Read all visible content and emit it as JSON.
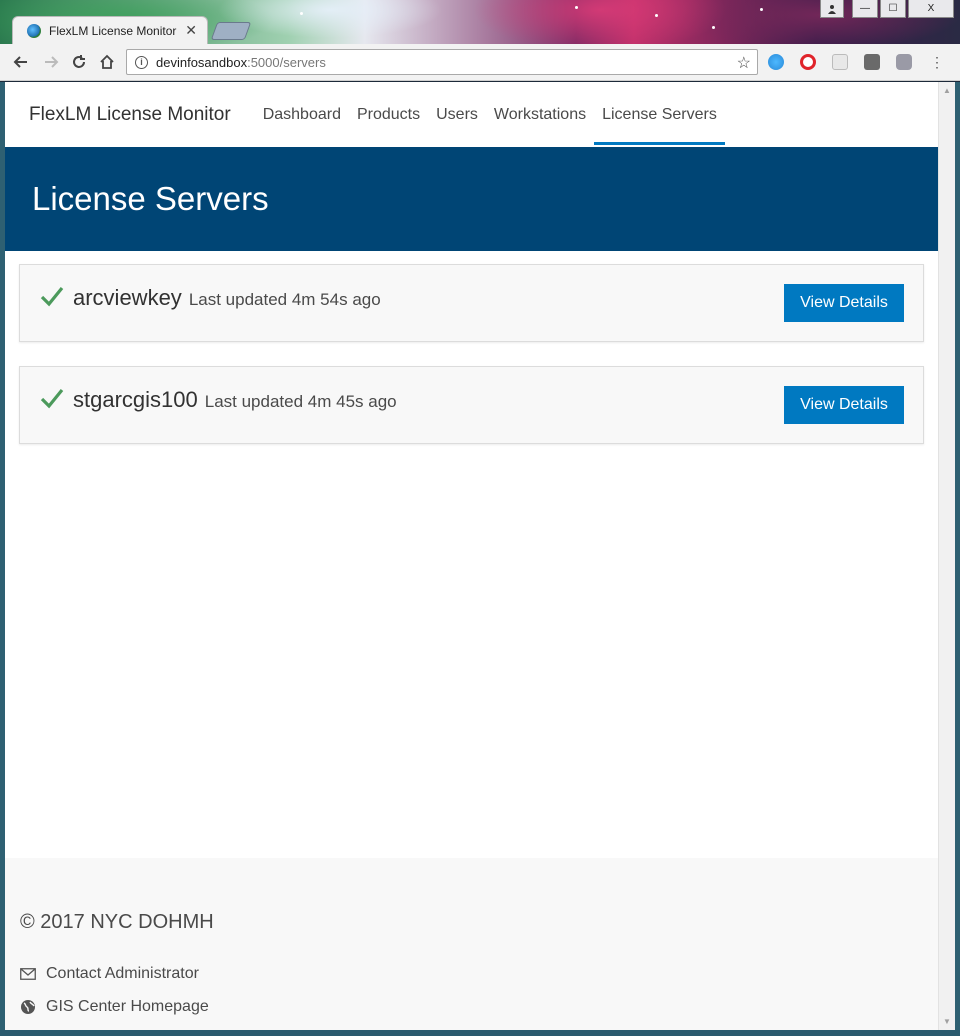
{
  "browser": {
    "tab_title": "FlexLM License Monitor",
    "tab_close": "✕",
    "url_host": "devinfosandbox",
    "url_path": ":5000/servers",
    "window_controls": {
      "minimize": "—",
      "maximize": "☐",
      "close": "X"
    }
  },
  "nav": {
    "brand": "FlexLM License Monitor",
    "links": [
      "Dashboard",
      "Products",
      "Users",
      "Workstations",
      "License Servers"
    ],
    "active": "License Servers"
  },
  "hero": {
    "title": "License Servers"
  },
  "servers": [
    {
      "name": "arcviewkey",
      "status": "up",
      "updated": "Last updated 4m 54s ago",
      "button": "View Details"
    },
    {
      "name": "stgarcgis100",
      "status": "up",
      "updated": "Last updated 4m 45s ago",
      "button": "View Details"
    }
  ],
  "footer": {
    "copyright": "© 2017 NYC DOHMH",
    "links": [
      {
        "label": "Contact Administrator",
        "icon": "envelope-icon"
      },
      {
        "label": "GIS Center Homepage",
        "icon": "globe-icon"
      }
    ]
  },
  "colors": {
    "primary": "#0079c1",
    "hero": "#004575",
    "check": "#35ac46"
  }
}
